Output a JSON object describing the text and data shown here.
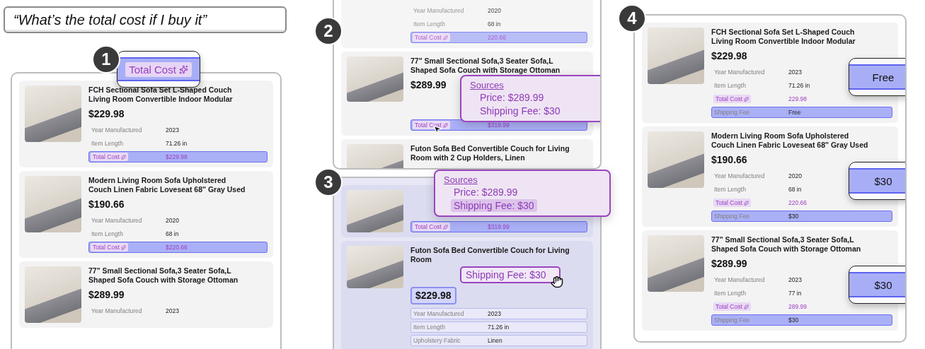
{
  "query": "“What’s the total cost if I buy it”",
  "steps": [
    {
      "number": "1",
      "tinted": false,
      "lens": {
        "tag": "Total Cost"
      },
      "cards": [
        {
          "photo": true,
          "title": "FCH Sectional Sofa Set L-Shaped Couch Living Room Convertible Indoor Modular",
          "price": "$229.98",
          "rows": [
            {
              "kind": "plain",
              "label": "Year Manufactured",
              "value": "2023",
              "highlighted": false
            },
            {
              "kind": "plain",
              "label": "Item Length",
              "value": "71.26 in",
              "highlighted": false
            },
            {
              "kind": "ai",
              "label": "Total Cost",
              "value": "$229.98",
              "highlighted": true
            }
          ]
        },
        {
          "photo": true,
          "title": "Modern Living Room Sofa Upholstered Couch Linen Fabric Loveseat 68\" Gray Used",
          "price": "$190.66",
          "rows": [
            {
              "kind": "plain",
              "label": "Year Manufactured",
              "value": "2020",
              "highlighted": false
            },
            {
              "kind": "plain",
              "label": "Item Length",
              "value": "68 in",
              "highlighted": false
            },
            {
              "kind": "ai",
              "label": "Total Cost",
              "value": "$220.66",
              "highlighted": true
            }
          ]
        },
        {
          "photo": true,
          "title": "77\" Small Sectional Sofa,3 Seater Sofa,L Shaped Sofa Couch with Storage Ottoman",
          "price": "$289.99",
          "rows": [
            {
              "kind": "plain",
              "label": "Year Manufactured",
              "value": "2023",
              "highlighted": false
            }
          ]
        }
      ]
    },
    {
      "number": "2",
      "tinted": false,
      "cards": [
        {
          "photo": false,
          "faded": true,
          "rows": [
            {
              "kind": "plain",
              "label": "Year Manufactured",
              "value": "2020",
              "highlighted": false
            },
            {
              "kind": "plain",
              "label": "Item Length",
              "value": "68 in",
              "highlighted": false
            },
            {
              "kind": "ai",
              "label": "Total Cost",
              "value": "220.66",
              "highlighted": true
            }
          ]
        },
        {
          "photo": true,
          "faded": false,
          "title": "77\" Small Sectional Sofa,3 Seater Sofa,L Shaped Sofa Couch with Storage Ottoman",
          "price": "$289.99",
          "popover": {
            "heading": "Sources",
            "lines": [
              {
                "text": "Price: $289.99",
                "selected": false
              },
              {
                "text": "Shipping Fee: $30",
                "selected": false
              }
            ]
          },
          "rows": [
            {
              "kind": "ai",
              "label": "Total Cost",
              "value": "$319.99",
              "highlighted": true,
              "pointer": true
            }
          ]
        },
        {
          "photo": true,
          "faded": false,
          "title": "Futon Sofa Bed Convertible Couch for Living Room with 2 Cup Holders, Linen"
        }
      ]
    },
    {
      "number": "3",
      "tinted": true,
      "popover": {
        "heading": "Sources",
        "lines": [
          {
            "text": "Price: $289.99",
            "selected": false
          },
          {
            "text": "Shipping Fee: $30",
            "selected": true
          }
        ]
      },
      "cards": [
        {
          "photo": true,
          "rows": [
            {
              "kind": "ai",
              "label": "Total Cost",
              "value": "$319.99",
              "highlighted": true
            }
          ]
        },
        {
          "photo": true,
          "price_outlined": true,
          "title": "Futon Sofa Bed Convertible Couch for Living Room",
          "drag_chip": "Shipping Fee: $30",
          "price": "$229.98",
          "rows": [
            {
              "kind": "boxed",
              "label": "Year Manufactured",
              "value": "2023",
              "highlighted": false
            },
            {
              "kind": "boxed",
              "label": "Item Length",
              "value": "71.26 in",
              "highlighted": false
            },
            {
              "kind": "boxed",
              "label": "Upholstery Fabric",
              "value": "Linen",
              "highlighted": false
            }
          ]
        }
      ]
    },
    {
      "number": "4",
      "tinted": false,
      "cards": [
        {
          "photo": true,
          "title": "FCH Sectional Sofa Set L-Shaped Couch Living Room Convertible Indoor Modular",
          "price": "$229.98",
          "lens": "Free",
          "rows": [
            {
              "kind": "plain",
              "label": "Year Manufactured",
              "value": "2023",
              "highlighted": false
            },
            {
              "kind": "plain",
              "label": "Item Length",
              "value": "71.26 in",
              "highlighted": false
            },
            {
              "kind": "ai",
              "label": "Total Cost",
              "value": "229.98",
              "highlighted": false
            },
            {
              "kind": "plain",
              "label": "Shipping Fee",
              "value": "Free",
              "highlighted": true
            }
          ]
        },
        {
          "photo": true,
          "title": "Modern Living Room Sofa Upholstered Couch Linen Fabric Loveseat 68\" Gray Used",
          "price": "$190.66",
          "lens": "$30",
          "rows": [
            {
              "kind": "plain",
              "label": "Year Manufactured",
              "value": "2020",
              "highlighted": false
            },
            {
              "kind": "plain",
              "label": "Item Length",
              "value": "68 in",
              "highlighted": false
            },
            {
              "kind": "ai",
              "label": "Total Cost",
              "value": "220.66",
              "highlighted": false
            },
            {
              "kind": "plain",
              "label": "Shipping Fee",
              "value": "$30",
              "highlighted": true
            }
          ]
        },
        {
          "photo": true,
          "title": "77\" Small Sectional Sofa,3 Seater Sofa,L Shaped Sofa Couch with Storage Ottoman",
          "price": "$289.99",
          "lens": "$30",
          "rows": [
            {
              "kind": "plain",
              "label": "Year Manufactured",
              "value": "2023",
              "highlighted": false
            },
            {
              "kind": "plain",
              "label": "Item Length",
              "value": "77 in",
              "highlighted": false
            },
            {
              "kind": "ai",
              "label": "Total Cost",
              "value": "289.99",
              "highlighted": false
            },
            {
              "kind": "plain",
              "label": "Shipping Fee",
              "value": "$30",
              "highlighted": true
            }
          ]
        }
      ]
    }
  ]
}
